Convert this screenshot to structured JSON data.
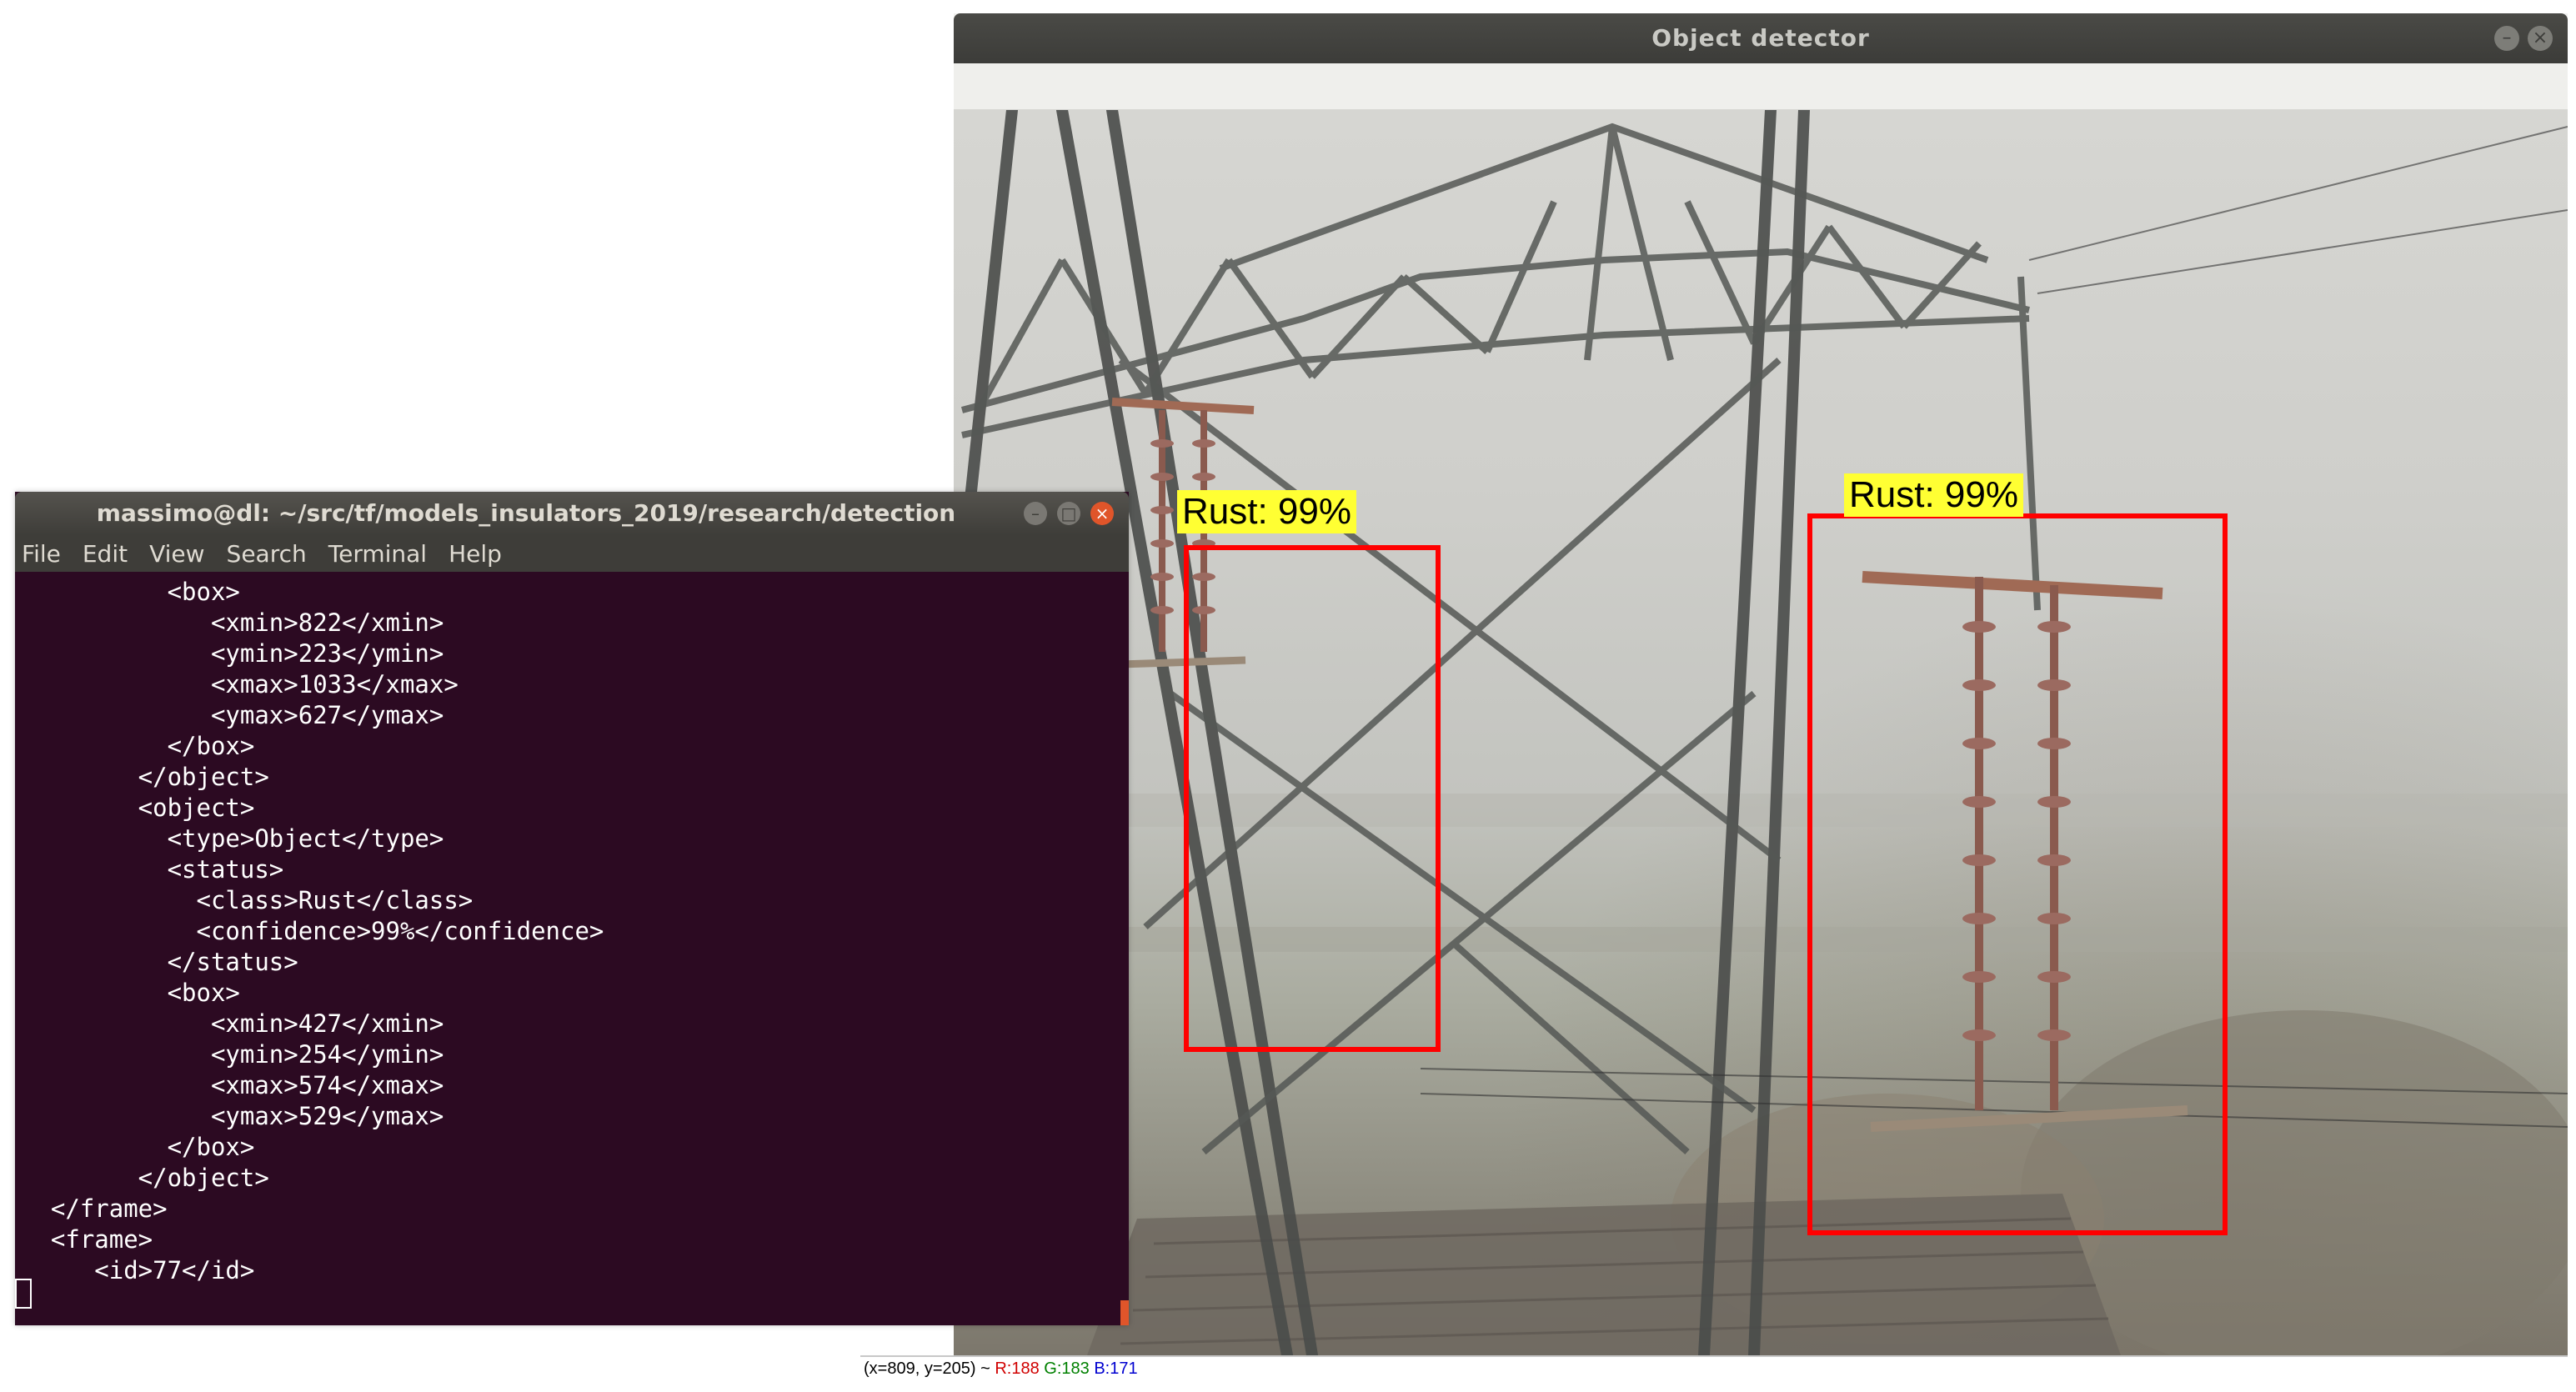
{
  "detector": {
    "title": "Object detector",
    "detections": [
      {
        "label": "Rust: 99%"
      },
      {
        "label": "Rust: 99%"
      }
    ],
    "status": {
      "coords": "(x=809, y=205) ~ ",
      "r": "R:188",
      "g": "G:183",
      "b": "B:171"
    }
  },
  "terminal": {
    "title": "massimo@dl: ~/src/tf/models_insulators_2019/research/detection",
    "menu": [
      "File",
      "Edit",
      "View",
      "Search",
      "Terminal",
      "Help"
    ],
    "lines": [
      "          <box>",
      "             <xmin>822</xmin>",
      "             <ymin>223</ymin>",
      "             <xmax>1033</xmax>",
      "             <ymax>627</ymax>",
      "          </box>",
      "        </object>",
      "        <object>",
      "          <type>Object</type>",
      "          <status>",
      "            <class>Rust</class>",
      "            <confidence>99%</confidence>",
      "          </status>",
      "          <box>",
      "             <xmin>427</xmin>",
      "             <ymin>254</ymin>",
      "             <xmax>574</xmax>",
      "             <ymax>529</ymax>",
      "          </box>",
      "        </object>",
      "  </frame>",
      "  <frame>",
      "     <id>77</id>"
    ]
  },
  "colors": {
    "terminal_bg": "#2c0a22",
    "box_border": "#ff0000",
    "label_bg": "#ffff33",
    "close_button": "#e0552a"
  }
}
